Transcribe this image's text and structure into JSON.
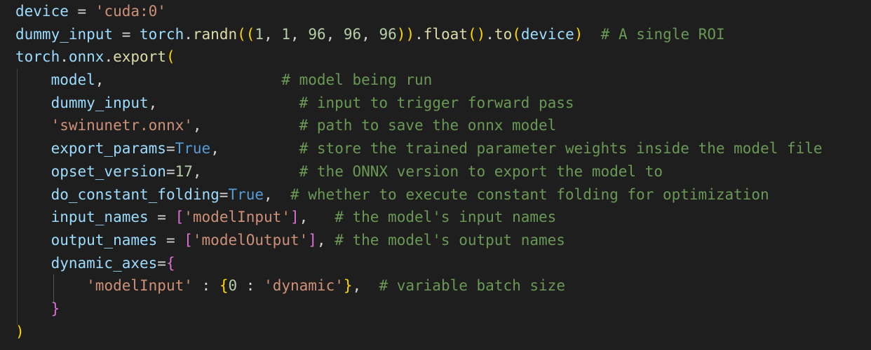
{
  "editor": {
    "lines": [
      [
        {
          "t": "device",
          "c": "var"
        },
        {
          "t": " = ",
          "c": "punc"
        },
        {
          "t": "'cuda:0'",
          "c": "str"
        }
      ],
      [
        {
          "t": "dummy_input",
          "c": "var"
        },
        {
          "t": " = ",
          "c": "punc"
        },
        {
          "t": "torch",
          "c": "var"
        },
        {
          "t": ".",
          "c": "punc"
        },
        {
          "t": "randn",
          "c": "fn"
        },
        {
          "t": "((",
          "c": "brace"
        },
        {
          "t": "1",
          "c": "num"
        },
        {
          "t": ", ",
          "c": "punc"
        },
        {
          "t": "1",
          "c": "num"
        },
        {
          "t": ", ",
          "c": "punc"
        },
        {
          "t": "96",
          "c": "num"
        },
        {
          "t": ", ",
          "c": "punc"
        },
        {
          "t": "96",
          "c": "num"
        },
        {
          "t": ", ",
          "c": "punc"
        },
        {
          "t": "96",
          "c": "num"
        },
        {
          "t": "))",
          "c": "brace"
        },
        {
          "t": ".",
          "c": "punc"
        },
        {
          "t": "float",
          "c": "fn"
        },
        {
          "t": "()",
          "c": "brace"
        },
        {
          "t": ".",
          "c": "punc"
        },
        {
          "t": "to",
          "c": "fn"
        },
        {
          "t": "(",
          "c": "brace"
        },
        {
          "t": "device",
          "c": "var"
        },
        {
          "t": ")",
          "c": "brace"
        },
        {
          "t": "  # A single ROI",
          "c": "cm"
        }
      ],
      [
        {
          "t": "torch",
          "c": "var"
        },
        {
          "t": ".",
          "c": "punc"
        },
        {
          "t": "onnx",
          "c": "var"
        },
        {
          "t": ".",
          "c": "punc"
        },
        {
          "t": "export",
          "c": "fn"
        },
        {
          "t": "(",
          "c": "brace"
        }
      ],
      [
        {
          "t": "    ",
          "c": "punc"
        },
        {
          "t": "model",
          "c": "var"
        },
        {
          "t": ",                    ",
          "c": "punc"
        },
        {
          "t": "# model being run",
          "c": "cm"
        }
      ],
      [
        {
          "t": "    ",
          "c": "punc"
        },
        {
          "t": "dummy_input",
          "c": "var"
        },
        {
          "t": ",                ",
          "c": "punc"
        },
        {
          "t": "# input to trigger forward pass",
          "c": "cm"
        }
      ],
      [
        {
          "t": "    ",
          "c": "punc"
        },
        {
          "t": "'swinunetr.onnx'",
          "c": "str"
        },
        {
          "t": ",           ",
          "c": "punc"
        },
        {
          "t": "# path to save the onnx model",
          "c": "cm"
        }
      ],
      [
        {
          "t": "    ",
          "c": "punc"
        },
        {
          "t": "export_params",
          "c": "var"
        },
        {
          "t": "=",
          "c": "punc"
        },
        {
          "t": "True",
          "c": "kw"
        },
        {
          "t": ",         ",
          "c": "punc"
        },
        {
          "t": "# store the trained parameter weights inside the model file",
          "c": "cm"
        }
      ],
      [
        {
          "t": "    ",
          "c": "punc"
        },
        {
          "t": "opset_version",
          "c": "var"
        },
        {
          "t": "=",
          "c": "punc"
        },
        {
          "t": "17",
          "c": "num"
        },
        {
          "t": ",           ",
          "c": "punc"
        },
        {
          "t": "# the ONNX version to export the model to",
          "c": "cm"
        }
      ],
      [
        {
          "t": "    ",
          "c": "punc"
        },
        {
          "t": "do_constant_folding",
          "c": "var"
        },
        {
          "t": "=",
          "c": "punc"
        },
        {
          "t": "True",
          "c": "kw"
        },
        {
          "t": ",  ",
          "c": "punc"
        },
        {
          "t": "# whether to execute constant folding for optimization",
          "c": "cm"
        }
      ],
      [
        {
          "t": "    ",
          "c": "punc"
        },
        {
          "t": "input_names",
          "c": "var"
        },
        {
          "t": " = ",
          "c": "punc"
        },
        {
          "t": "[",
          "c": "brace2"
        },
        {
          "t": "'modelInput'",
          "c": "str"
        },
        {
          "t": "]",
          "c": "brace2"
        },
        {
          "t": ",   ",
          "c": "punc"
        },
        {
          "t": "# the model's input names",
          "c": "cm"
        }
      ],
      [
        {
          "t": "    ",
          "c": "punc"
        },
        {
          "t": "output_names",
          "c": "var"
        },
        {
          "t": " = ",
          "c": "punc"
        },
        {
          "t": "[",
          "c": "brace2"
        },
        {
          "t": "'modelOutput'",
          "c": "str"
        },
        {
          "t": "]",
          "c": "brace2"
        },
        {
          "t": ", ",
          "c": "punc"
        },
        {
          "t": "# the model's output names",
          "c": "cm"
        }
      ],
      [
        {
          "t": "    ",
          "c": "punc"
        },
        {
          "t": "dynamic_axes",
          "c": "var"
        },
        {
          "t": "=",
          "c": "punc"
        },
        {
          "t": "{",
          "c": "brace2"
        }
      ],
      [
        {
          "t": "        ",
          "c": "punc"
        },
        {
          "t": "'modelInput'",
          "c": "str"
        },
        {
          "t": " : ",
          "c": "punc"
        },
        {
          "t": "{",
          "c": "brace"
        },
        {
          "t": "0",
          "c": "num"
        },
        {
          "t": " : ",
          "c": "punc"
        },
        {
          "t": "'dynamic'",
          "c": "str"
        },
        {
          "t": "}",
          "c": "brace"
        },
        {
          "t": ",  ",
          "c": "punc"
        },
        {
          "t": "# variable batch size",
          "c": "cm"
        }
      ],
      [
        {
          "t": "    ",
          "c": "punc"
        },
        {
          "t": "}",
          "c": "brace2"
        }
      ],
      [
        {
          "t": ")",
          "c": "brace"
        }
      ]
    ]
  }
}
